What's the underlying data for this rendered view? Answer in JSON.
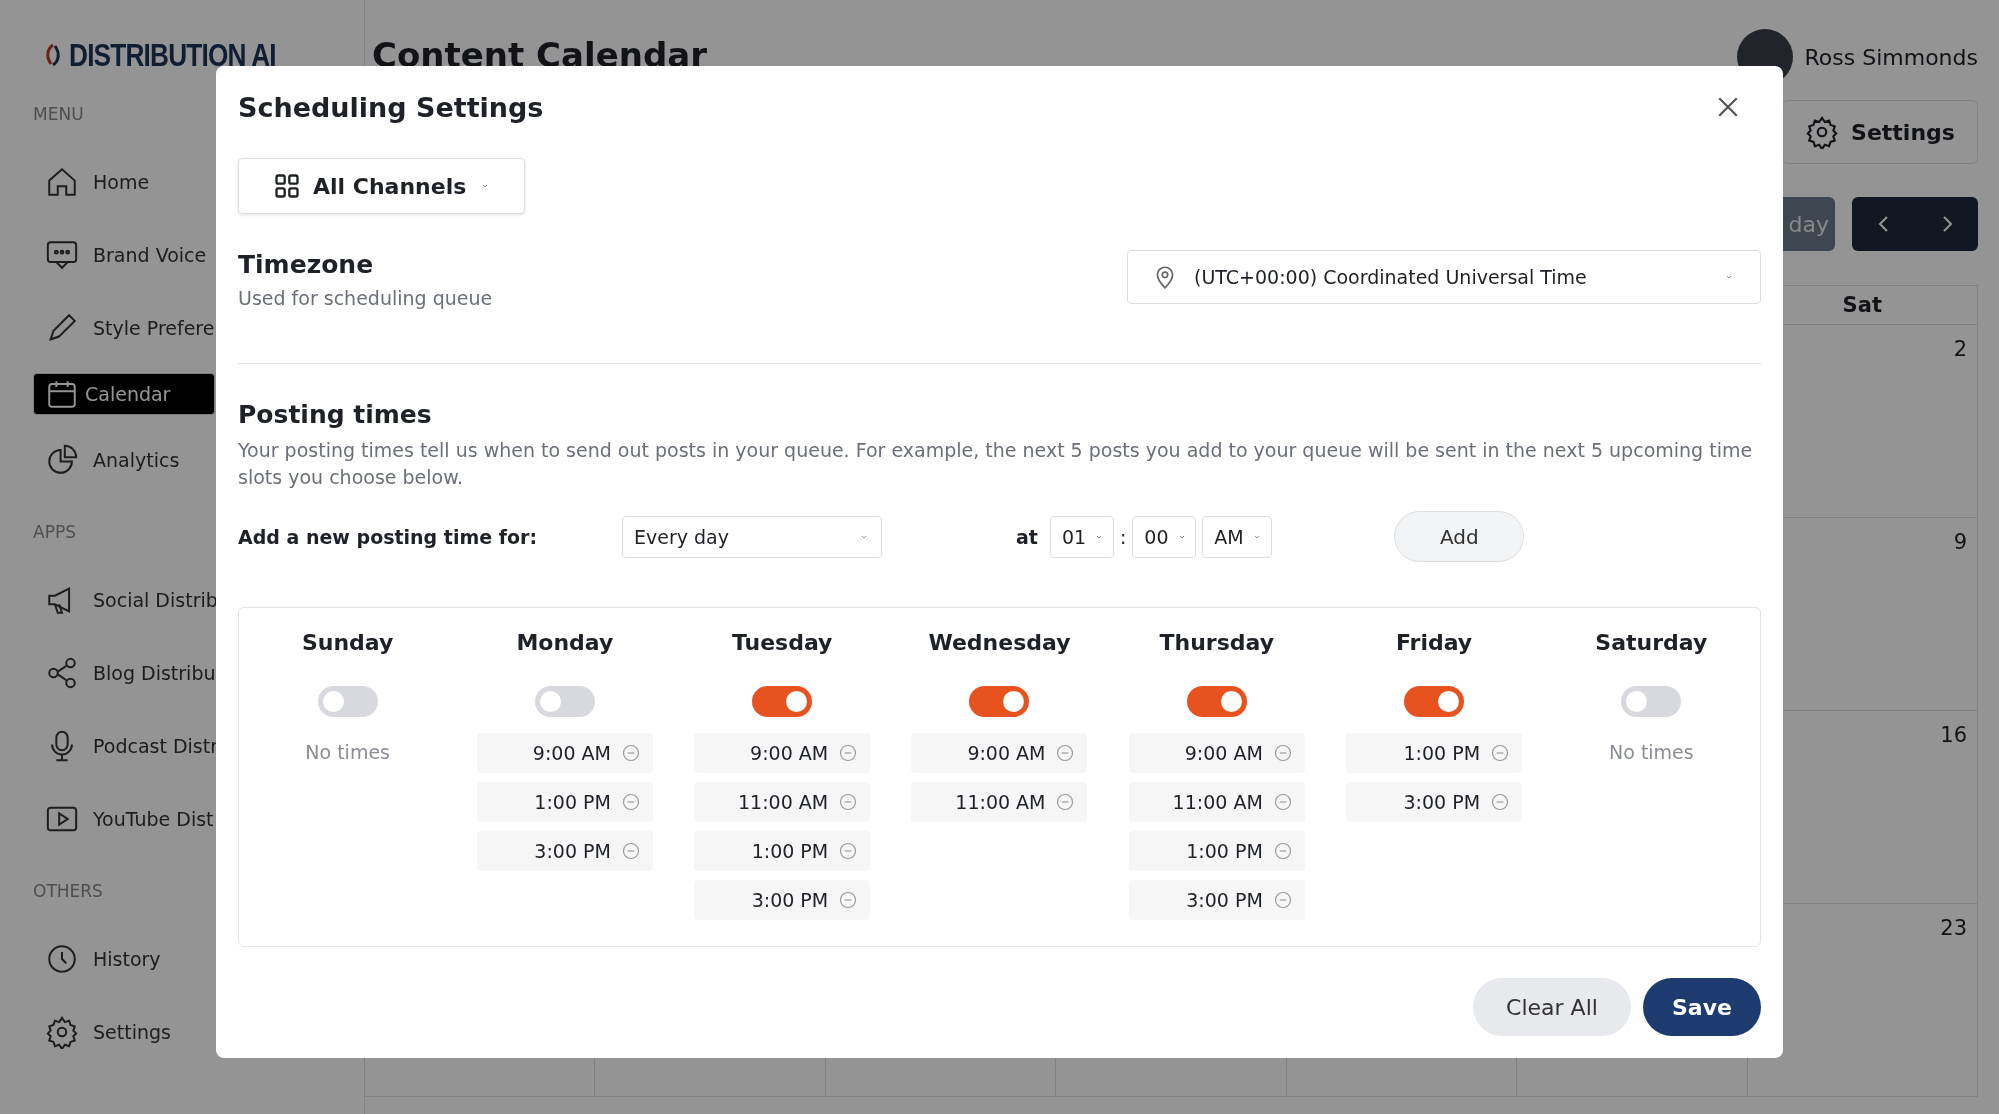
{
  "logo": {
    "text": "DISTRIBUTION AI"
  },
  "sidebar": {
    "sections": [
      {
        "heading": "MENU",
        "items": [
          {
            "label": "Home",
            "selected": false
          },
          {
            "label": "Brand Voice",
            "selected": false
          },
          {
            "label": "Style Prefere",
            "selected": false
          },
          {
            "label": "Calendar",
            "selected": true
          },
          {
            "label": "Analytics",
            "selected": false
          }
        ]
      },
      {
        "heading": "APPS",
        "items": [
          {
            "label": "Social Distrib",
            "selected": false
          },
          {
            "label": "Blog Distribu",
            "selected": false
          },
          {
            "label": "Podcast Distr",
            "selected": false
          },
          {
            "label": "YouTube Dist",
            "selected": false
          }
        ]
      },
      {
        "heading": "OTHERS",
        "items": [
          {
            "label": "History",
            "selected": false
          },
          {
            "label": "Settings",
            "selected": false
          }
        ]
      }
    ]
  },
  "header": {
    "title": "Content Calendar",
    "user_name": "Ross Simmonds"
  },
  "toolbar": {
    "settings_button": "Settings",
    "today_button": "day"
  },
  "calendar": {
    "saturday_heading": "Sat",
    "saturday_dates": [
      "2",
      "9",
      "16",
      "23"
    ]
  },
  "modal": {
    "title": "Scheduling Settings",
    "channel_filter": "All Channels",
    "timezone": {
      "heading": "Timezone",
      "description": "Used for scheduling queue",
      "value": "(UTC+00:00) Coordinated Universal Time"
    },
    "posting_times": {
      "heading": "Posting times",
      "description": "Your posting times tell us when to send out posts in your queue. For example, the next 5 posts you add to your queue will be sent in the next 5 upcoming time slots you choose below.",
      "add_label": "Add a new posting time for:",
      "day_option": "Every day",
      "at_label": "at",
      "hour": "01",
      "separator": ":",
      "minute": "00",
      "period": "AM",
      "add_button": "Add"
    },
    "days": [
      {
        "name": "Sunday",
        "on": false,
        "empty_text": "No times"
      },
      {
        "name": "Monday",
        "on": false,
        "times": [
          "9:00 AM",
          "1:00 PM",
          "3:00 PM"
        ]
      },
      {
        "name": "Tuesday",
        "on": true,
        "times": [
          "9:00 AM",
          "11:00 AM",
          "1:00 PM",
          "3:00 PM"
        ]
      },
      {
        "name": "Wednesday",
        "on": true,
        "times": [
          "9:00 AM",
          "11:00 AM"
        ]
      },
      {
        "name": "Thursday",
        "on": true,
        "times": [
          "9:00 AM",
          "11:00 AM",
          "1:00 PM",
          "3:00 PM"
        ]
      },
      {
        "name": "Friday",
        "on": true,
        "times": [
          "1:00 PM",
          "3:00 PM"
        ]
      },
      {
        "name": "Saturday",
        "on": false,
        "empty_text": "No times"
      }
    ],
    "clear_button": "Clear All",
    "save_button": "Save"
  }
}
